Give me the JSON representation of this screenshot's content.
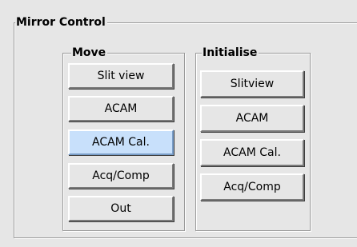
{
  "mirror_control": {
    "title": "Mirror Control"
  },
  "move": {
    "title": "Move",
    "buttons": [
      "Slit view",
      "ACAM",
      "ACAM Cal.",
      "Acq/Comp",
      "Out"
    ],
    "active": "ACAM Cal."
  },
  "initialise": {
    "title": "Initialise",
    "buttons": [
      "Slitview",
      "ACAM",
      "ACAM Cal.",
      "Acq/Comp"
    ]
  },
  "colors": {
    "background": "#e6e6e6",
    "active_button": "#c8e0fb"
  }
}
